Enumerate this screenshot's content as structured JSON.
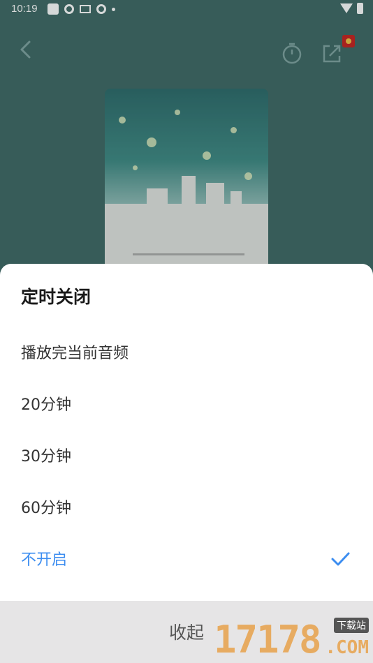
{
  "status_bar": {
    "time": "10:19"
  },
  "sheet": {
    "title": "定时关闭",
    "options": [
      {
        "label": "播放完当前音频",
        "selected": false
      },
      {
        "label": "20分钟",
        "selected": false
      },
      {
        "label": "30分钟",
        "selected": false
      },
      {
        "label": "60分钟",
        "selected": false
      },
      {
        "label": "不开启",
        "selected": true
      }
    ],
    "collapse_label": "收起"
  },
  "watermark": {
    "digits": "17178",
    "tag": "下载站",
    "suffix": ".COM"
  },
  "colors": {
    "accent": "#3c8df0",
    "background": "#3f6864",
    "footer": "#e6e5e6"
  },
  "icons": {
    "back": "chevron-left-icon",
    "timer": "timer-icon",
    "share": "share-icon",
    "check": "check-icon"
  }
}
